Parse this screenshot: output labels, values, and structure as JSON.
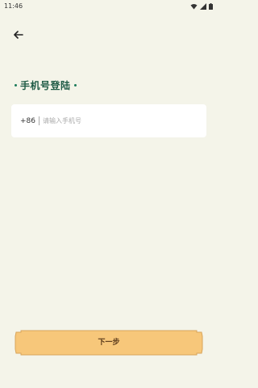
{
  "status_bar": {
    "time": "11:46",
    "icons": [
      "wifi-icon",
      "signal-icon",
      "battery-icon"
    ]
  },
  "header": {
    "back_icon": "arrow-left-icon"
  },
  "login": {
    "title": "手机号登陆",
    "country_code": "+86",
    "phone_placeholder": "请输入手机号",
    "phone_value": ""
  },
  "footer": {
    "next_label": "下一步"
  },
  "colors": {
    "background": "#f4f4e9",
    "title": "#1e5a45",
    "accent_dot": "#1c7a5a",
    "button_fill": "#f7c77a",
    "button_border": "#d8a45a"
  }
}
